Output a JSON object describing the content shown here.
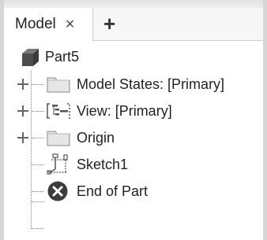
{
  "tab": {
    "label": "Model",
    "close_glyph": "×",
    "add_glyph": "+"
  },
  "tree": {
    "root": {
      "label": "Part5",
      "icon": "part-cube-icon"
    },
    "items": [
      {
        "label": "Model States: [Primary]",
        "icon": "folder-icon",
        "expandable": true
      },
      {
        "label": "View: [Primary]",
        "icon": "view-icon",
        "expandable": true
      },
      {
        "label": "Origin",
        "icon": "folder-icon",
        "expandable": true
      },
      {
        "label": "Sketch1",
        "icon": "sketch-icon",
        "expandable": false
      },
      {
        "label": "End of Part",
        "icon": "end-of-part-icon",
        "expandable": false
      }
    ]
  },
  "colors": {
    "end_of_part": "#3c3c3c",
    "folder_fill": "#e6e6e6",
    "cube": "#555555"
  }
}
